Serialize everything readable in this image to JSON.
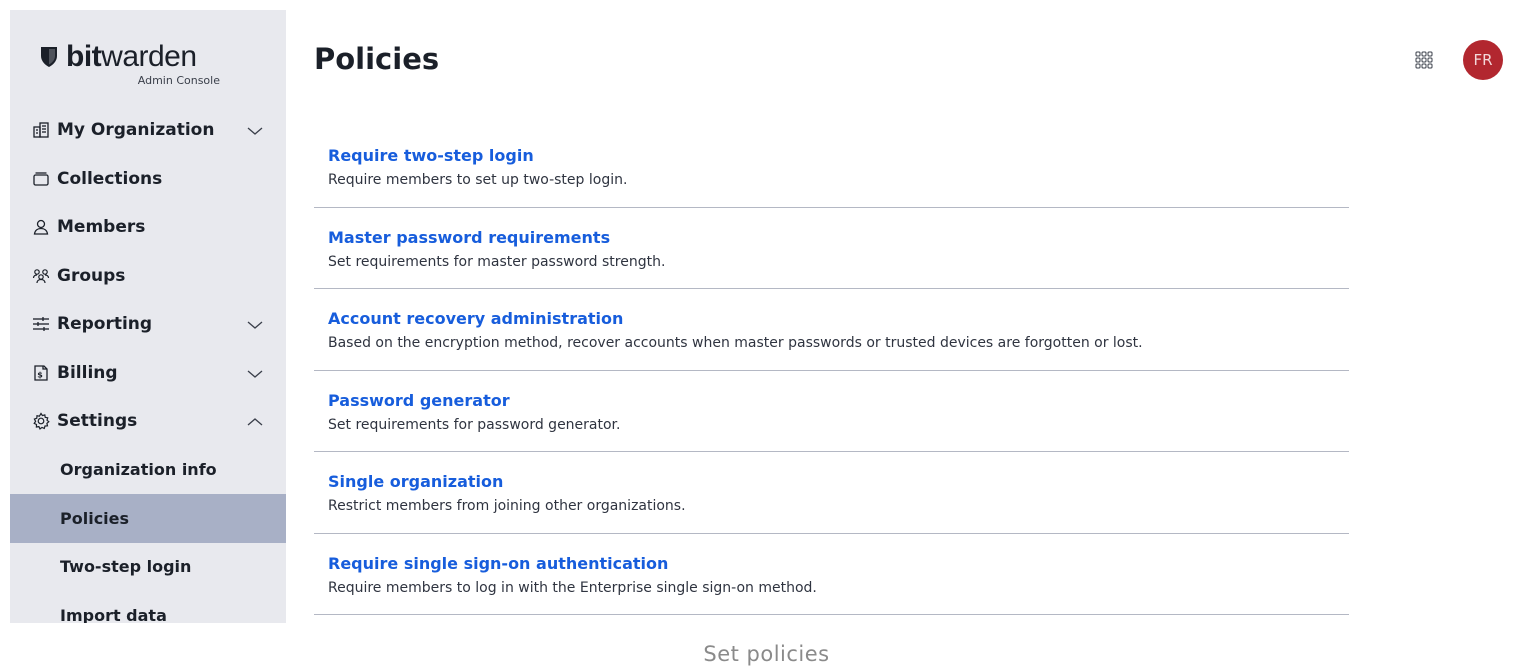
{
  "brand": {
    "bit": "bit",
    "warden": "warden",
    "subtitle": "Admin Console"
  },
  "sidebar": {
    "items": [
      {
        "label": "My Organization",
        "icon": "building-icon",
        "expandable": true,
        "expanded": false
      },
      {
        "label": "Collections",
        "icon": "collection-icon",
        "expandable": false
      },
      {
        "label": "Members",
        "icon": "user-icon",
        "expandable": false
      },
      {
        "label": "Groups",
        "icon": "users-icon",
        "expandable": false
      },
      {
        "label": "Reporting",
        "icon": "sliders-icon",
        "expandable": true,
        "expanded": false
      },
      {
        "label": "Billing",
        "icon": "billing-icon",
        "expandable": true,
        "expanded": false
      },
      {
        "label": "Settings",
        "icon": "cog-icon",
        "expandable": true,
        "expanded": true
      }
    ],
    "settings_children": [
      {
        "label": "Organization info",
        "active": false
      },
      {
        "label": "Policies",
        "active": true
      },
      {
        "label": "Two-step login",
        "active": false
      },
      {
        "label": "Import data",
        "active": false
      }
    ]
  },
  "header": {
    "title": "Policies",
    "avatar_initials": "FR"
  },
  "policies": [
    {
      "name": "Require two-step login",
      "description": "Require members to set up two-step login."
    },
    {
      "name": "Master password requirements",
      "description": "Set requirements for master password strength."
    },
    {
      "name": "Account recovery administration",
      "description": "Based on the encryption method, recover accounts when master passwords or trusted devices are forgotten or lost."
    },
    {
      "name": "Password generator",
      "description": "Set requirements for password generator."
    },
    {
      "name": "Single organization",
      "description": "Restrict members from joining other organizations."
    },
    {
      "name": "Require single sign-on authentication",
      "description": "Require members to log in with the Enterprise single sign-on method."
    }
  ],
  "caption": "Set policies",
  "colors": {
    "sidebar_bg": "#e8e9ee",
    "active_item_bg": "#a8b0c6",
    "link": "#175ddc",
    "avatar_bg": "#b2272f"
  }
}
